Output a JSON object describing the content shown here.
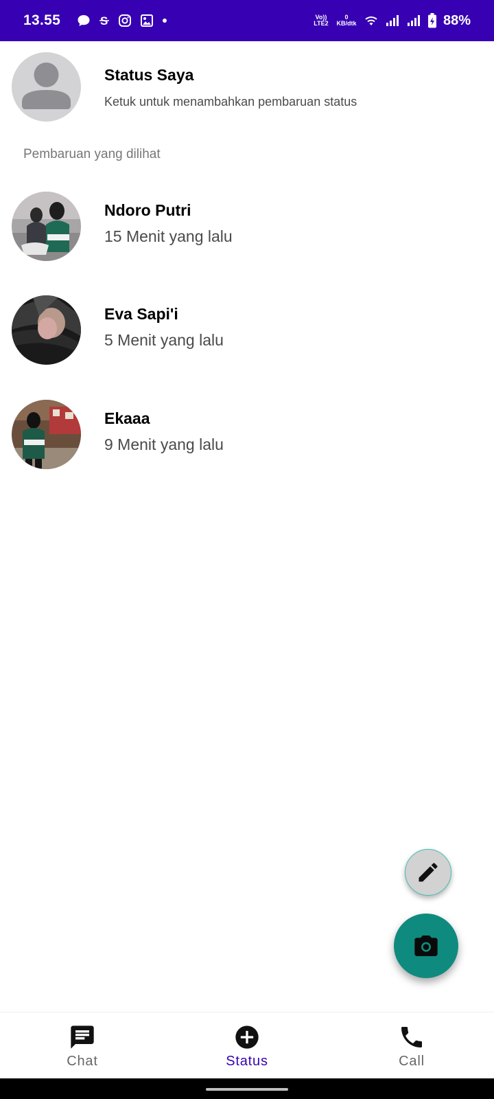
{
  "status_bar": {
    "time": "13.55",
    "volte_label": "Vo)) LTE2",
    "speed_value": "0",
    "speed_unit": "KB/dtk",
    "battery": "88%"
  },
  "my_status": {
    "title": "Status Saya",
    "subtitle": "Ketuk untuk menambahkan pembaruan status"
  },
  "section_label": "Pembaruan yang dilihat",
  "contacts": [
    {
      "name": "Ndoro Putri",
      "time": "15 Menit yang lalu"
    },
    {
      "name": "Eva Sapi'i",
      "time": "5 Menit yang lalu"
    },
    {
      "name": "Ekaaa",
      "time": "9 Menit yang lalu"
    }
  ],
  "bottom_nav": [
    {
      "label": "Chat",
      "icon": "chat-icon"
    },
    {
      "label": "Status",
      "icon": "add-circle-icon",
      "active": true
    },
    {
      "label": "Call",
      "icon": "phone-icon"
    }
  ],
  "colors": {
    "primary": "#3700b3",
    "accent": "#0f8a7e",
    "fab_secondary": "#d2d2d2"
  }
}
